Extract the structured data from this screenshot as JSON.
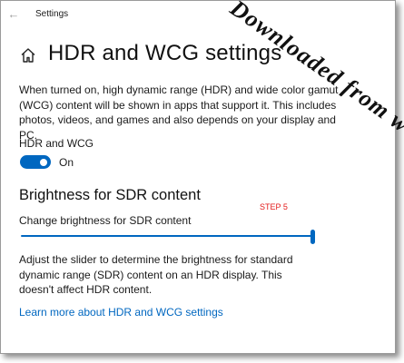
{
  "window": {
    "title": "Settings",
    "back_icon": "back-arrow-icon"
  },
  "page": {
    "home_icon": "home-icon",
    "title": "HDR and WCG settings",
    "description": "When turned on, high dynamic range (HDR) and wide color gamut (WCG) content will be shown in apps that support it. This includes photos, videos, and games and also depends on your display and PC."
  },
  "hdr_toggle": {
    "label": "HDR and WCG",
    "state": "On",
    "is_on": true
  },
  "sdr_section": {
    "heading": "Brightness for SDR content",
    "slider_label": "Change brightness for SDR content",
    "slider_value_fraction": 1.0,
    "help_text": "Adjust the slider to determine the brightness for standard dynamic range (SDR) content on an HDR display. This doesn't affect HDR content."
  },
  "annotation": {
    "step_label": "STEP 5",
    "color": "#e31b1b"
  },
  "link": {
    "text": "Learn more about HDR and WCG settings"
  },
  "watermark": {
    "text": "Downloaded from www.vandenborre"
  },
  "colors": {
    "accent": "#0067c0",
    "annotation": "#e31b1b"
  }
}
